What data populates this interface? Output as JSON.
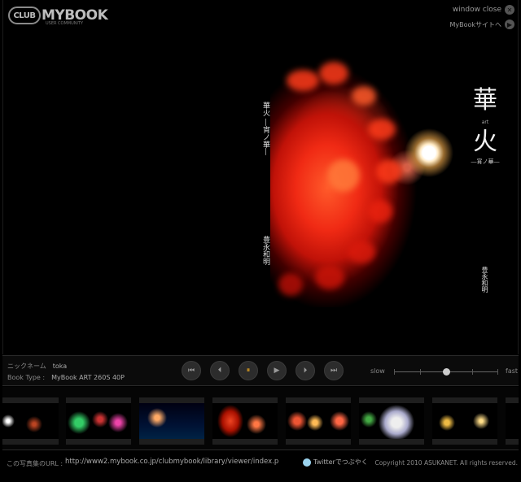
{
  "header": {
    "logo_club": "CLUB",
    "logo_brand": "MYBOOK",
    "logo_sub": "USER COMMUNITY",
    "window_close": "window close",
    "site_link": "MyBookサイトへ"
  },
  "book": {
    "left_title": "華火 ―宵ノ華―",
    "left_author": "豊永和明",
    "title_kanji_1": "華",
    "title_art": "art",
    "title_kanji_2": "火",
    "title_sub": "―宵ノ華―",
    "right_author": "豊永和明"
  },
  "info": {
    "nickname_label": "ニックネーム",
    "nickname_value": "toka",
    "booktype_label": "Book Type :",
    "booktype_value": "MyBook ART 260S 40P"
  },
  "speed": {
    "slow": "slow",
    "fast": "fast",
    "level": 0.5
  },
  "footer": {
    "url_label": "この写真集のURL :",
    "url": "http://www2.mybook.co.jp/clubmybook/library/viewer/index.p",
    "twitter": "Twitterでつぶやく",
    "copyright": "Copyright 2010 ASUKANET. All rights reserved."
  },
  "colors": {
    "accent": "#e0a020"
  }
}
